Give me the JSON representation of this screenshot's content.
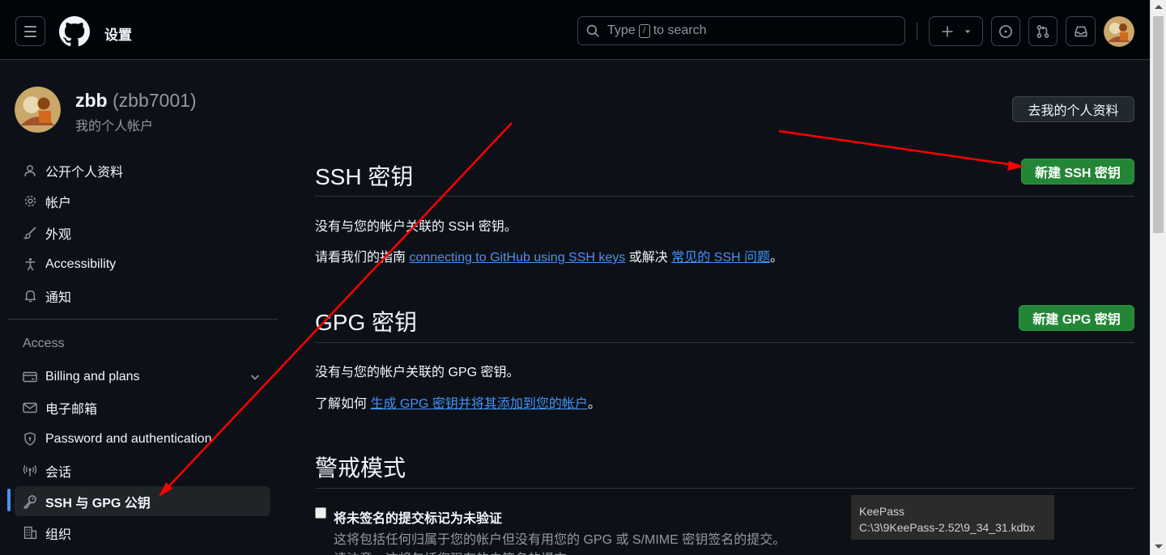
{
  "header": {
    "title": "设置",
    "search_prefix": "Type",
    "search_kbd": "/",
    "search_suffix": "to search"
  },
  "profile": {
    "name": "zbb",
    "login": "(zbb7001)",
    "subtitle": "我的个人帐户",
    "goto_button": "去我的个人资料"
  },
  "sidebar": {
    "items": [
      {
        "label": "公开个人资料",
        "icon": "person-icon"
      },
      {
        "label": "帐户",
        "icon": "gear-icon"
      },
      {
        "label": "外观",
        "icon": "paintbrush-icon"
      },
      {
        "label": "Accessibility",
        "icon": "accessibility-icon"
      },
      {
        "label": "通知",
        "icon": "bell-icon"
      }
    ],
    "access_heading": "Access",
    "access_items": [
      {
        "label": "Billing and plans",
        "icon": "credit-card-icon"
      },
      {
        "label": "电子邮箱",
        "icon": "mail-icon"
      },
      {
        "label": "Password and authentication",
        "icon": "shield-lock-icon"
      },
      {
        "label": "会话",
        "icon": "broadcast-icon"
      },
      {
        "label": "SSH 与 GPG 公钥",
        "icon": "key-icon",
        "active": true
      },
      {
        "label": "组织",
        "icon": "organization-icon"
      }
    ]
  },
  "ssh": {
    "title": "SSH 密钥",
    "new_button": "新建 SSH 密钥",
    "empty_text": "没有与您的帐户关联的 SSH 密钥。",
    "guide_prefix": "请看我们的指南",
    "guide_link": "connecting to GitHub using SSH keys",
    "guide_middle": "或解决",
    "guide_link2": "常见的 SSH 问题",
    "guide_suffix": "。"
  },
  "gpg": {
    "title": "GPG 密钥",
    "new_button": "新建 GPG 密钥",
    "empty_text": "没有与您的帐户关联的 GPG 密钥。",
    "learn_prefix": "了解如何",
    "learn_link": "生成 GPG 密钥并将其添加到您的帐户",
    "learn_suffix": "。"
  },
  "vigilant": {
    "title": "警戒模式",
    "checkbox_label": "将未签名的提交标记为未验证",
    "checkbox_checked": false,
    "desc": "这将包括任何归属于您的帐户但没有用您的 GPG 或 S/MIME 密钥签名的提交。",
    "desc2": "请注意，这将包括您现有的未签名的提交。"
  },
  "tooltip": {
    "line1": "KeePass",
    "line2": "C:\\3\\9KeePass-2.52\\9_34_31.kdbx"
  },
  "colors": {
    "background": "#0d1117",
    "header_bg": "#010409",
    "accent_blue": "#4493f8",
    "button_green": "#238636",
    "annotation_red": "#ff0000"
  }
}
